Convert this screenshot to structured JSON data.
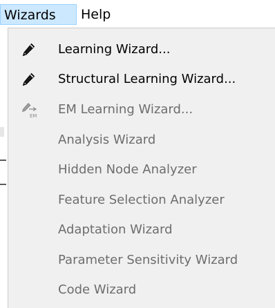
{
  "menubar": {
    "items": [
      {
        "label": "Wizards"
      },
      {
        "label": "Help"
      }
    ]
  },
  "menu": {
    "items": [
      {
        "label": "Learning Wizard...",
        "enabled": true,
        "icon": "pen-icon"
      },
      {
        "label": "Structural Learning Wizard...",
        "enabled": true,
        "icon": "pen-icon"
      },
      {
        "label": "EM Learning Wizard...",
        "enabled": false,
        "icon": "em-pen-icon"
      },
      {
        "label": "Analysis Wizard",
        "enabled": false
      },
      {
        "label": "Hidden Node Analyzer",
        "enabled": false
      },
      {
        "label": "Feature Selection Analyzer",
        "enabled": false
      },
      {
        "label": "Adaptation Wizard",
        "enabled": false
      },
      {
        "label": "Parameter Sensitivity Wizard",
        "enabled": false
      },
      {
        "label": "Code Wizard",
        "enabled": false
      }
    ]
  },
  "colors": {
    "active_menu_bg": "#cce8ff",
    "active_menu_border": "#99d1ff",
    "dropdown_bg": "#f0f0f0",
    "enabled_text": "#000000",
    "disabled_text": "#6d6d6d"
  }
}
